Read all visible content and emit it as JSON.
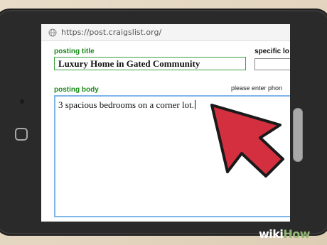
{
  "browser": {
    "url": "https://post.craigslist.org/",
    "url_icon": "globe-icon"
  },
  "form": {
    "title_label": "posting title",
    "title_value": "Luxury Home in Gated Community",
    "location_label": "specific lo",
    "body_label": "posting body",
    "body_hint": "please enter phon",
    "body_value": "3 spacious bedrooms on a corner lot."
  },
  "overlay": {
    "cursor_icon": "arrow-cursor-icon",
    "cursor_color": "#d32f3f"
  },
  "watermark": {
    "wiki": "wiki",
    "how": "How"
  },
  "colors": {
    "label_green": "#1a8a1a",
    "body_border": "#7fb6ea",
    "tablet": "#2a2a2a"
  }
}
